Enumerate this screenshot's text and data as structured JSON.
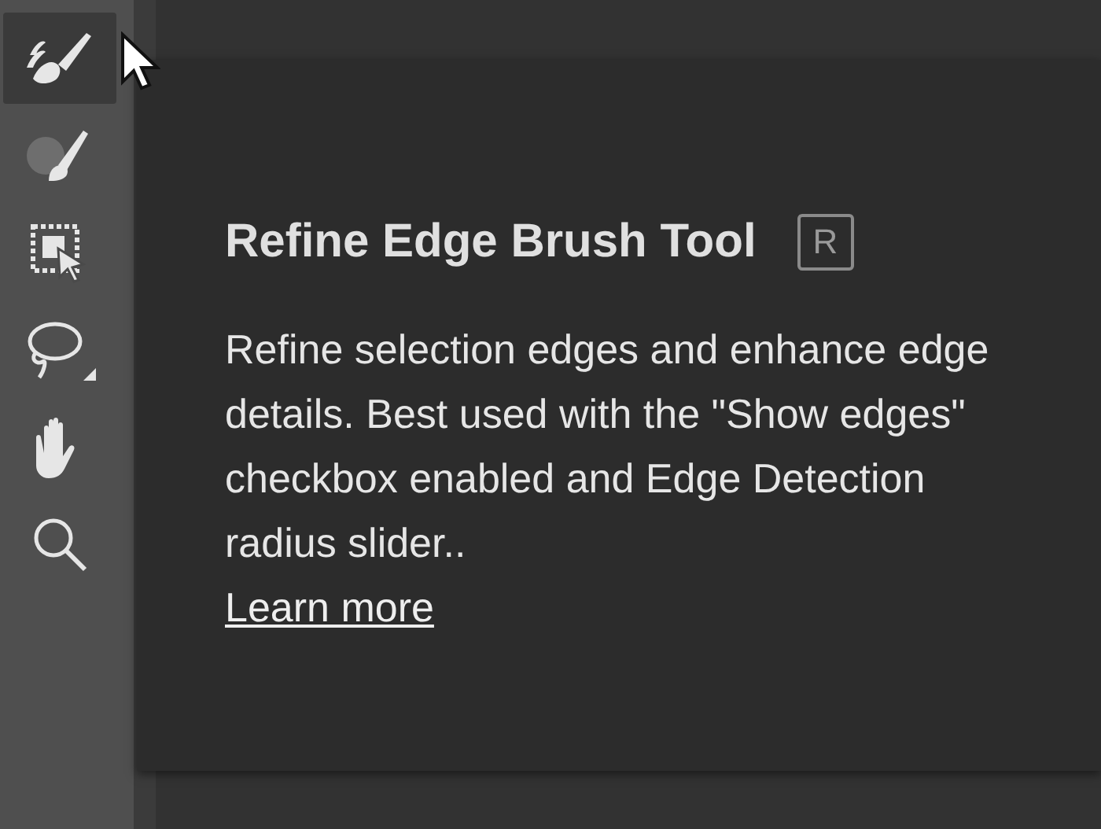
{
  "toolbar": {
    "tools": [
      {
        "kind": "refine-brush",
        "selected": true
      },
      {
        "kind": "brush",
        "selected": false
      },
      {
        "kind": "object-select",
        "selected": false
      },
      {
        "kind": "lasso",
        "selected": false
      },
      {
        "kind": "hand",
        "selected": false
      },
      {
        "kind": "zoom",
        "selected": false
      }
    ]
  },
  "tooltip": {
    "title": "Refine Edge Brush Tool",
    "shortcut": "R",
    "description": "Refine selection edges and enhance edge details. Best used with the \"Show edges\" checkbox enabled and Edge Detection radius slider..",
    "link": "Learn more"
  }
}
